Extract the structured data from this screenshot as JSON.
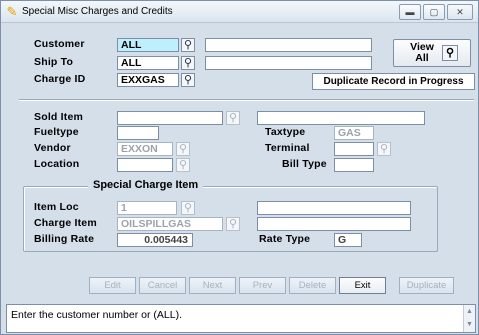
{
  "window": {
    "title": "Special Misc Charges and Credits",
    "controls": {
      "minimize": "▬",
      "maximize": "▢",
      "close": "✕"
    }
  },
  "header": {
    "customer_label": "Customer",
    "customer_value": "ALL",
    "customer_name": "",
    "ship_to_label": "Ship To",
    "ship_to_value": "ALL",
    "ship_to_name": "",
    "charge_id_label": "Charge ID",
    "charge_id_value": "EXXGAS",
    "view_all_label": "View All",
    "duplicate_status": "Duplicate Record in Progress"
  },
  "details": {
    "sold_item_label": "Sold Item",
    "sold_item_value": "",
    "sold_item_desc": "",
    "fueltype_label": "Fueltype",
    "fueltype_value": "",
    "taxtype_label": "Taxtype",
    "taxtype_value": "GAS",
    "vendor_label": "Vendor",
    "vendor_value": "EXXON",
    "terminal_label": "Terminal",
    "terminal_value": "",
    "location_label": "Location",
    "location_value": "",
    "bill_type_label": "Bill Type",
    "bill_type_value": ""
  },
  "special_charge": {
    "group_title": "Special Charge Item",
    "item_loc_label": "Item Loc",
    "item_loc_value": "1",
    "item_loc_desc": "",
    "charge_item_label": "Charge Item",
    "charge_item_value": "OILSPILLGAS",
    "charge_item_desc": "",
    "billing_rate_label": "Billing Rate",
    "billing_rate_value": "0.005443",
    "rate_type_label": "Rate Type",
    "rate_type_value": "G"
  },
  "buttons": {
    "edit": "Edit",
    "cancel": "Cancel",
    "next": "Next",
    "prev": "Prev",
    "delete": "Delete",
    "exit": "Exit",
    "duplicate": "Duplicate"
  },
  "statusbar": {
    "message": "Enter the customer number or (ALL)."
  },
  "colors": {
    "window_bg": "#d5dfe9",
    "highlight_field": "#bdeffc",
    "title_icon": "#e6a100"
  },
  "icons": {
    "lookup": "magnifier-icon",
    "title": "tool-icon"
  }
}
